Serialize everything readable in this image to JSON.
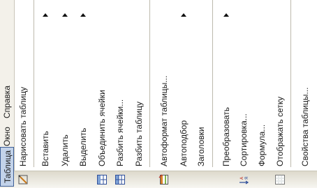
{
  "menubar": {
    "items": [
      {
        "label": "Таблица",
        "active": true
      },
      {
        "label": "Окно",
        "active": false
      },
      {
        "label": "Справка",
        "active": false
      }
    ]
  },
  "menu": {
    "items": [
      {
        "label": "Нарисовать таблицу",
        "icon": "draw-table-icon",
        "submenu": false
      },
      {
        "separator": true
      },
      {
        "label": "Вставить",
        "submenu": true
      },
      {
        "label": "Удалить",
        "submenu": true
      },
      {
        "label": "Выделить",
        "submenu": true
      },
      {
        "label": "Объединить ячейки",
        "icon": "merge-cells-icon",
        "submenu": false
      },
      {
        "label": "Разбить ячейки...",
        "icon": "split-cells-icon",
        "submenu": false
      },
      {
        "label": "Разбить таблицу",
        "submenu": false
      },
      {
        "separator": true
      },
      {
        "label": "Автоформат таблицы...",
        "icon": "table-autoformat-icon",
        "submenu": false
      },
      {
        "label": "Автоподбор",
        "submenu": true
      },
      {
        "label": "Заголовки",
        "submenu": false
      },
      {
        "separator": true
      },
      {
        "label": "Преобразовать",
        "submenu": true
      },
      {
        "label": "Сортировка...",
        "icon": "sort-icon",
        "submenu": false
      },
      {
        "label": "Формула...",
        "submenu": false
      },
      {
        "label": "Отображать сетку",
        "icon": "gridlines-icon",
        "submenu": false
      },
      {
        "separator": true
      },
      {
        "label": "Свойства таблицы...",
        "submenu": false
      }
    ]
  },
  "colors": {
    "menubar_bg": "#f3f1ea",
    "highlight": "#c3d3ea",
    "highlight_border": "#3e5f96",
    "icon_strip": "#e6e3d8"
  }
}
